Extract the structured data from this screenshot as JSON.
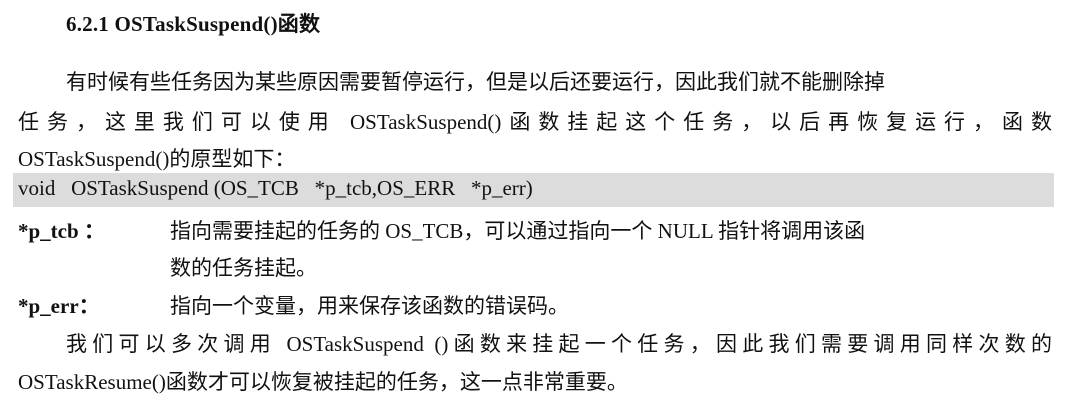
{
  "heading": "6.2.1 OSTaskSuspend()函数",
  "intro": {
    "line1": "有时候有些任务因为某些原因需要暂停运行，但是以后还要运行，因此我们就不能删除掉",
    "line2": "任务，这里我们可以使用 OSTaskSuspend()函数挂起这个任务，以后再恢复运行，函数",
    "line3": "OSTaskSuspend()的原型如下："
  },
  "prototype": "void   OSTaskSuspend (OS_TCB   *p_tcb,OS_ERR   *p_err)",
  "params": [
    {
      "name": "*p_tcb ：",
      "desc_line1": "指向需要挂起的任务的 OS_TCB，可以通过指向一个 NULL 指针将调用该函",
      "desc_line2": "数的任务挂起。"
    },
    {
      "name": "*p_err：",
      "desc_line1": "指向一个变量，用来保存该函数的错误码。"
    }
  ],
  "closing": {
    "line1": "我们可以多次调用 OSTaskSuspend ()函数来挂起一个任务，因此我们需要调用同样次数的",
    "line2": "OSTaskResume()函数才可以恢复被挂起的任务，这一点非常重要。"
  }
}
